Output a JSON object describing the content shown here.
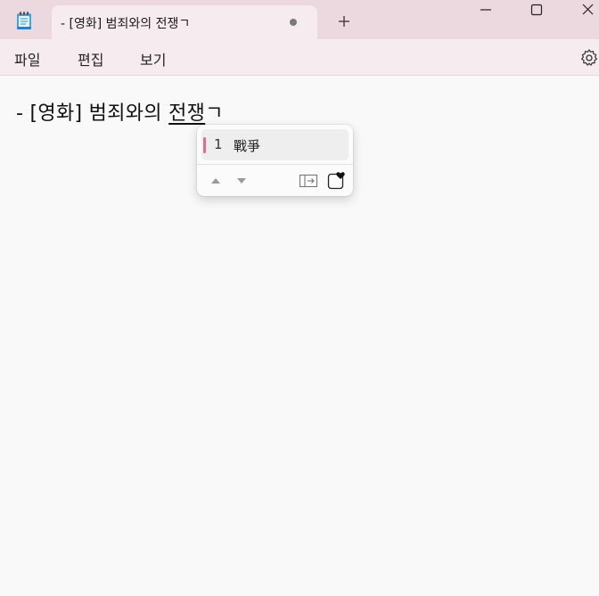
{
  "tab": {
    "title": "- [영화] 범죄와의 전쟁ㄱ"
  },
  "menu": {
    "items": [
      "파일",
      "편집",
      "보기"
    ]
  },
  "document": {
    "prefix": "- [영화] 범죄와의 ",
    "composing": "전쟁",
    "suffix": "ㄱ"
  },
  "ime_popup": {
    "candidates": [
      {
        "number": "1",
        "text": "戰爭"
      }
    ]
  },
  "colors": {
    "titlebar": "#ecd9df",
    "accent": "#d96f8a"
  },
  "icons": {
    "app": "notepad-icon",
    "new_tab": "plus-icon",
    "minimize": "minimize-icon",
    "maximize": "maximize-icon",
    "close": "close-icon",
    "settings": "gear-icon",
    "prev": "triangle-up-icon",
    "next": "triangle-down-icon",
    "expand": "expand-panel-icon",
    "favorite": "heart-icon"
  }
}
